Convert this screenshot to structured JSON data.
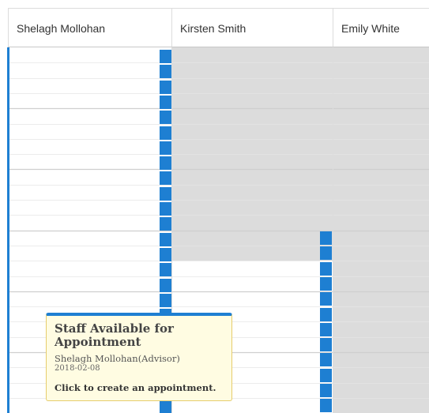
{
  "staff_columns": [
    {
      "name": "Shelagh Mollohan"
    },
    {
      "name": "Kirsten Smith"
    },
    {
      "name": "Emily White"
    }
  ],
  "tooltip": {
    "title": "Staff Available for Appointment",
    "staff": "Shelagh Mollohan(Advisor)",
    "date": "2018-02-08",
    "action": "Click to create an appointment."
  },
  "colors": {
    "available": "#1e7fd2",
    "unavailable": "#dcdcdc",
    "grid_line": "#e6e6e6",
    "hour_line": "#cfcfcf",
    "tooltip_bg": "#fffce2",
    "tooltip_border": "#e6cd6d"
  }
}
